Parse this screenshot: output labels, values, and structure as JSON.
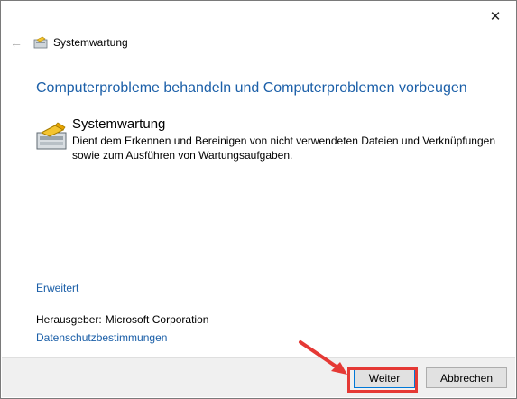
{
  "window": {
    "close_glyph": "✕",
    "back_glyph": "←",
    "nav_title": "Systemwartung"
  },
  "main": {
    "heading": "Computerprobleme behandeln und Computerproblemen vorbeugen",
    "item": {
      "title": "Systemwartung",
      "description": "Dient dem Erkennen und Bereinigen von nicht verwendeten Dateien und Verknüpfungen sowie zum Ausführen von Wartungsaufgaben."
    },
    "advanced_link": "Erweitert",
    "publisher_label": "Herausgeber:",
    "publisher_value": "Microsoft Corporation",
    "privacy_link": "Datenschutzbestimmungen"
  },
  "footer": {
    "next_label": "Weiter",
    "cancel_label": "Abbrechen"
  },
  "colors": {
    "link": "#1b5fa8",
    "annotation": "#e53935"
  }
}
